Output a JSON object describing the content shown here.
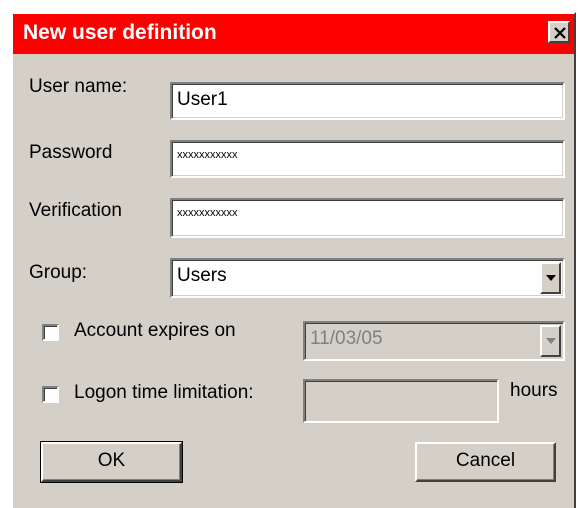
{
  "dialog": {
    "title": "New user definition",
    "title_bar_color": "#ff0000",
    "close_icon": "close-icon"
  },
  "form": {
    "username_label": "User name:",
    "username_value": "User1",
    "password_label": "Password",
    "password_value": "xxxxxxxxxxx",
    "verification_label": "Verification",
    "verification_value": "xxxxxxxxxxx",
    "group_label": "Group:",
    "group_value": "Users",
    "account_expires_label": "Account expires on",
    "account_expires_checked": false,
    "account_expires_value": "11/03/05",
    "logon_time_label": "Logon time limitation:",
    "logon_time_checked": false,
    "logon_time_value": "",
    "hours_label": "hours"
  },
  "buttons": {
    "ok_label": "OK",
    "cancel_label": "Cancel"
  }
}
